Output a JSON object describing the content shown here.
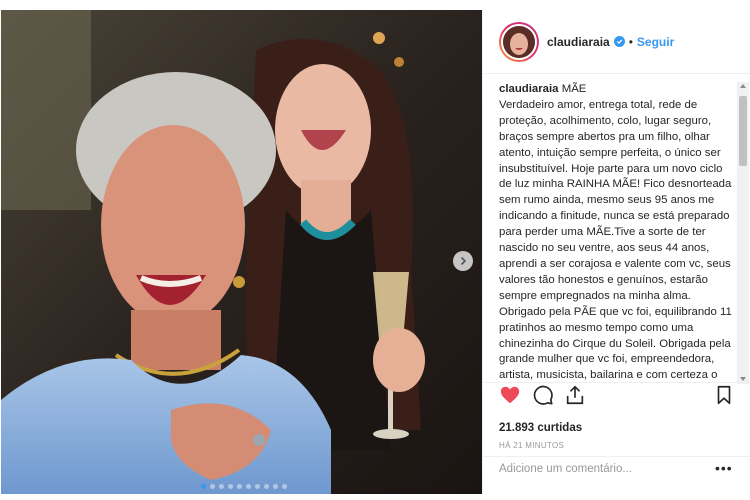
{
  "post": {
    "username": "claudiaraia",
    "follow_label": "Seguir",
    "separator": "•",
    "caption_title": "MÃE",
    "caption_body": "Verdadeiro amor, entrega total, rede de proteção, acolhimento, colo, lugar seguro, braços sempre abertos pra um filho, olhar atento, intuição sempre perfeita, o único ser insubstituível. Hoje parte para um novo ciclo de luz minha RAINHA MÃE! Fico desnorteada sem rumo ainda, mesmo seus 95 anos me indicando a finitude, nunca se está preparado para perder uma MÃE.Tive a sorte de ter nascido no seu ventre, aos seus 44 anos, aprendi a ser corajosa e valente com vc, seus valores tão honestos e genuínos, estarão sempre empregnados na minha alma. Obrigado pela PÃE que vc foi, equilibrando 11 pratinhos ao mesmo tempo como uma chinezinha do Cirque du Soleil. Obrigada pela grande mulher que vc foi, empreendedora, artista, musicista, bailarina e com certeza o seu melhor desempenho, o de MÃE! ODETTE MOTTA",
    "likes": "21.893 curtidas",
    "time": "HÁ 21 MINUTOS",
    "comment_placeholder": "Adicione um comentário...",
    "more": "•••"
  },
  "icons": {
    "like": "heart-icon",
    "comment": "comment-icon",
    "share": "share-icon",
    "save": "bookmark-icon",
    "verified": "verified-badge-icon",
    "next": "chevron-right-icon"
  },
  "colors": {
    "accent": "#3897f0",
    "heart": "#ed4956",
    "muted": "#999999"
  },
  "carousel": {
    "total_slides": 10,
    "active_slide": 1
  }
}
